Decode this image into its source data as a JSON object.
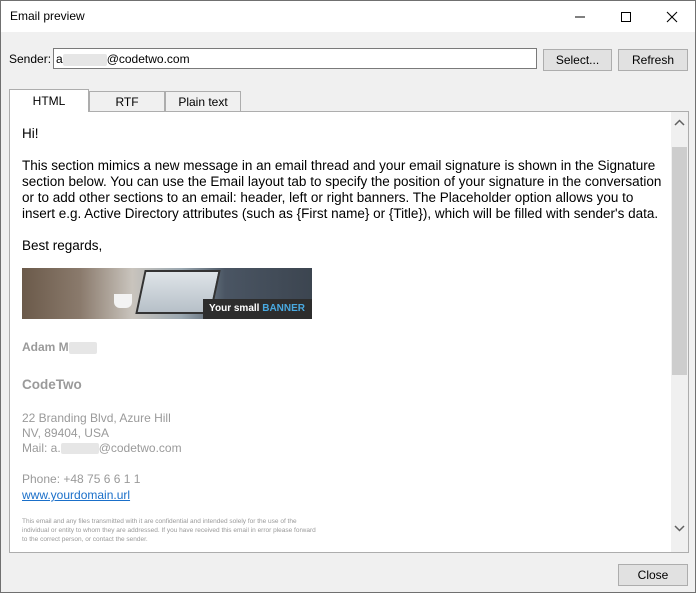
{
  "window": {
    "title": "Email preview",
    "controls": {
      "minimize": "minimize-icon",
      "maximize": "maximize-icon",
      "close": "close-icon"
    }
  },
  "sender": {
    "label": "Sender:",
    "value_prefix": "a",
    "value_suffix": "@codetwo.com"
  },
  "buttons": {
    "select": "Select...",
    "refresh": "Refresh",
    "close": "Close"
  },
  "tabs": [
    {
      "label": "HTML",
      "active": true
    },
    {
      "label": "RTF",
      "active": false
    },
    {
      "label": "Plain text",
      "active": false
    }
  ],
  "email": {
    "greeting": "Hi!",
    "body": "This section mimics a new message in an email thread and your email signature is shown in the Signature section below. You can use the Email layout tab to specify the position of your signature in the conversation or to add other sections to an email: header, left or right banners. The Placeholder option allows you to insert e.g. Active Directory attributes (such as {First name} or {Title}), which will be filled with sender's data.",
    "closing": "Best regards,",
    "banner": {
      "text_normal": "Your small ",
      "text_highlight": "BANNER",
      "highlight_color": "#49a9e0"
    },
    "signature": {
      "name_prefix": "Adam M",
      "company": "CodeTwo",
      "address_line1": "22 Branding Blvd, Azure Hill",
      "address_line2": "NV, 89404, USA",
      "mail_prefix": "Mail: a.",
      "mail_suffix": "@codetwo.com",
      "phone": "Phone: +48 75 6  6 1    1",
      "website": "www.yourdomain.url",
      "disclaimer": "This email and any files transmitted with it are confidential and intended solely for the use of the individual or entity to whom they are addressed. If you have received this email in error please forward to the correct person, or contact the sender."
    }
  },
  "colors": {
    "link": "#1a6fc9",
    "signature_gray": "#9a9a9a",
    "scroll_thumb": "#cdcdcd"
  }
}
